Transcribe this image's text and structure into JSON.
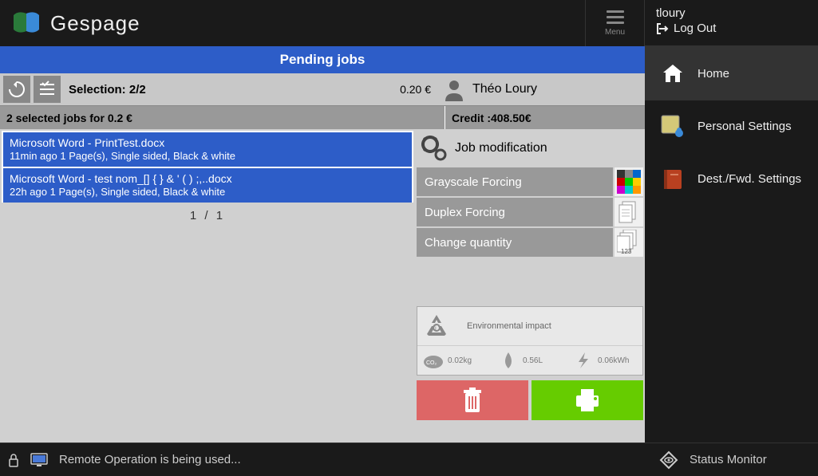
{
  "brand": "Gespage",
  "menu": {
    "label": "Menu"
  },
  "title": "Pending jobs",
  "toolbar": {
    "selection": "Selection: 2/2",
    "cost": "0.20 €",
    "user": "Théo Loury"
  },
  "summary": {
    "left": "2 selected jobs for 0.2 €",
    "right": "Credit :408.50€"
  },
  "jobs": [
    {
      "title": "Microsoft Word - PrintTest.docx",
      "detail": "11min ago  1 Page(s), Single sided, Black & white"
    },
    {
      "title": "Microsoft Word - test nom_[] { } &   ' ( ) ;,..docx",
      "detail": "22h ago  1 Page(s), Single sided, Black & white"
    }
  ],
  "pagination": "1 / 1",
  "modification": {
    "header": "Job modification",
    "grayscale": "Grayscale Forcing",
    "duplex": "Duplex Forcing",
    "quantity": "Change quantity"
  },
  "env": {
    "header": "Environmental impact",
    "co2": "0.02kg",
    "water": "0.56L",
    "energy": "0.06kWh"
  },
  "status": "Remote Operation is being used...",
  "user": {
    "name": "tloury",
    "logout": "Log Out"
  },
  "nav": {
    "home": "Home",
    "personal": "Personal Settings",
    "dest": "Dest./Fwd. Settings"
  },
  "status_monitor": "Status Monitor"
}
